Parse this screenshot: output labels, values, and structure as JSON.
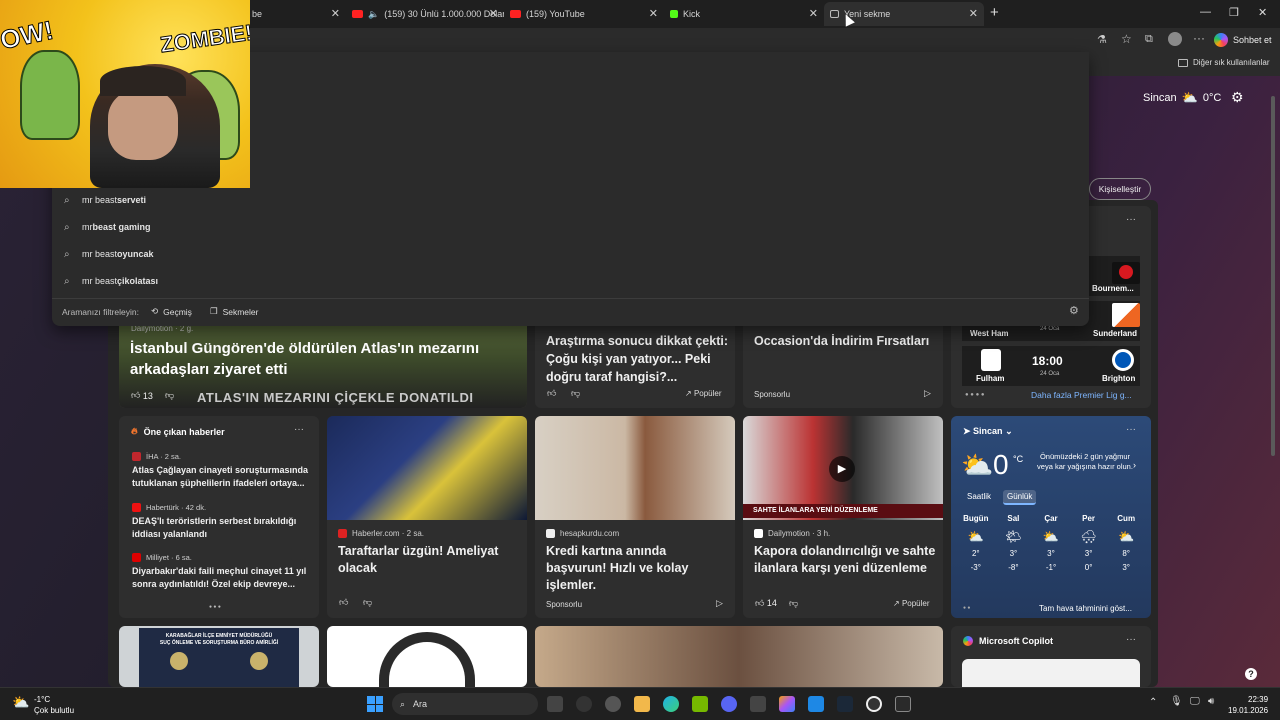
{
  "tabs": [
    {
      "label": "be",
      "color": "#e33"
    },
    {
      "label": "(159) 30 Ünlü 1.000.000 Dolar",
      "color": "#f22"
    },
    {
      "label": "(159) YouTube",
      "color": "#f22"
    },
    {
      "label": "Kick",
      "color": "#53fc18"
    },
    {
      "label": "Yeni sekme",
      "color": "#bbb"
    }
  ],
  "toolbar": {
    "chat_label": "Sohbet et",
    "other_favorites": "Diğer sık kullanılanlar"
  },
  "header": {
    "city": "Sincan",
    "temp": "0°C",
    "customize": "Kişiselleştir"
  },
  "suggestions": [
    {
      "prefix": "mr beast ",
      "bold": "serveti"
    },
    {
      "prefix": "mr",
      "bold": "beast gaming"
    },
    {
      "prefix": "mr beast ",
      "bold": "oyuncak"
    },
    {
      "prefix": "mr beast ",
      "bold": "çikolatası"
    }
  ],
  "filter": {
    "label": "Aramanızı filtreleyin:",
    "history": "Geçmiş",
    "tabs": "Sekmeler"
  },
  "cards_top": [
    {
      "source": "Dailymotion · 2 g.",
      "title": "İstanbul Güngören'de öldürülen Atlas'ın mezarını arkadaşları ziyaret etti",
      "likes": "13",
      "caption": "ATLAS'IN MEZARINI ÇİÇEKLE DONATILDI"
    },
    {
      "title": "Araştırma sonucu dikkat çekti: Çoğu kişi yan yatıyor... Peki doğru taraf hangisi?...",
      "popular": "Popüler"
    },
    {
      "title": "Occasion'da İndirim Fırsatları",
      "sponsored": "Sponsorlu"
    }
  ],
  "sports": {
    "rows": [
      {
        "left": "",
        "right": "Bournem...",
        "time": ""
      },
      {
        "left": "West Ham",
        "right": "Sunderland",
        "date": "24 Oca"
      },
      {
        "left": "Fulham",
        "right": "Brighton",
        "time": "18:00",
        "date": "24 Oca"
      }
    ],
    "more": "Daha fazla Premier Lig g..."
  },
  "top_news": {
    "heading": "Öne çıkan haberler",
    "items": [
      {
        "source": "İHA · 2 sa.",
        "title": "Atlas Çağlayan cinayeti soruşturmasında tutuklanan şüphelilerin ifadeleri ortaya..."
      },
      {
        "source": "Habertürk · 42 dk.",
        "title": "DEAŞ'lı teröristlerin serbest bırakıldığı iddiası yalanlandı"
      },
      {
        "source": "Milliyet · 6 sa.",
        "title": "Diyarbakır'daki faili meçhul cinayet 11 yıl sonra aydınlatıldı! Özel ekip devreye..."
      }
    ]
  },
  "cards_mid": [
    {
      "source": "Haberler.com · 2 sa.",
      "title": "Taraftarlar üzgün! Ameliyat olacak"
    },
    {
      "source": "hesapkurdu.com",
      "title": "Kredi kartına anında başvurun! Hızlı ve kolay işlemler.",
      "sponsored": "Sponsorlu"
    },
    {
      "source": "Dailymotion · 3 h.",
      "title": "Kapora dolandırıcılığı ve sahte ilanlara karşı yeni düzenleme",
      "likes": "14",
      "popular": "Popüler",
      "caption": "SAHTE İLANLARA YENİ DÜZENLEME"
    }
  ],
  "weather": {
    "city": "Sincan",
    "temp": "0",
    "unit": "°C",
    "forecast_note": "Önümüzdeki 2 gün yağmur veya kar yağışına hazır olun.",
    "tab_hourly": "Saatlik",
    "tab_daily": "Günlük",
    "days": [
      {
        "name": "Bugün",
        "high": "2°",
        "low": "-3°"
      },
      {
        "name": "Sal",
        "high": "3°",
        "low": "-8°"
      },
      {
        "name": "Çar",
        "high": "3°",
        "low": "-1°"
      },
      {
        "name": "Per",
        "high": "3°",
        "low": "0°"
      },
      {
        "name": "Cum",
        "high": "8°",
        "low": "3°"
      }
    ],
    "full_forecast": "Tam hava tahminini göst..."
  },
  "copilot": {
    "title": "Microsoft Copilot"
  },
  "bottom_cards": {
    "police_sign_line1": "KARABAĞLAR İLÇE EMNİYET MÜDÜRLÜĞÜ",
    "police_sign_line2": "SUÇ ÖNLEME VE SORUŞTURMA BÜRO AMİRLİĞİ"
  },
  "taskbar": {
    "weather_temp": "-1°C",
    "weather_desc": "Çok bulutlu",
    "search": "Ara",
    "time": "22:39",
    "date": "19.01.2026"
  },
  "webcam": {
    "art_text_left": "OW!",
    "art_text_right": "ZOMBIE!"
  }
}
